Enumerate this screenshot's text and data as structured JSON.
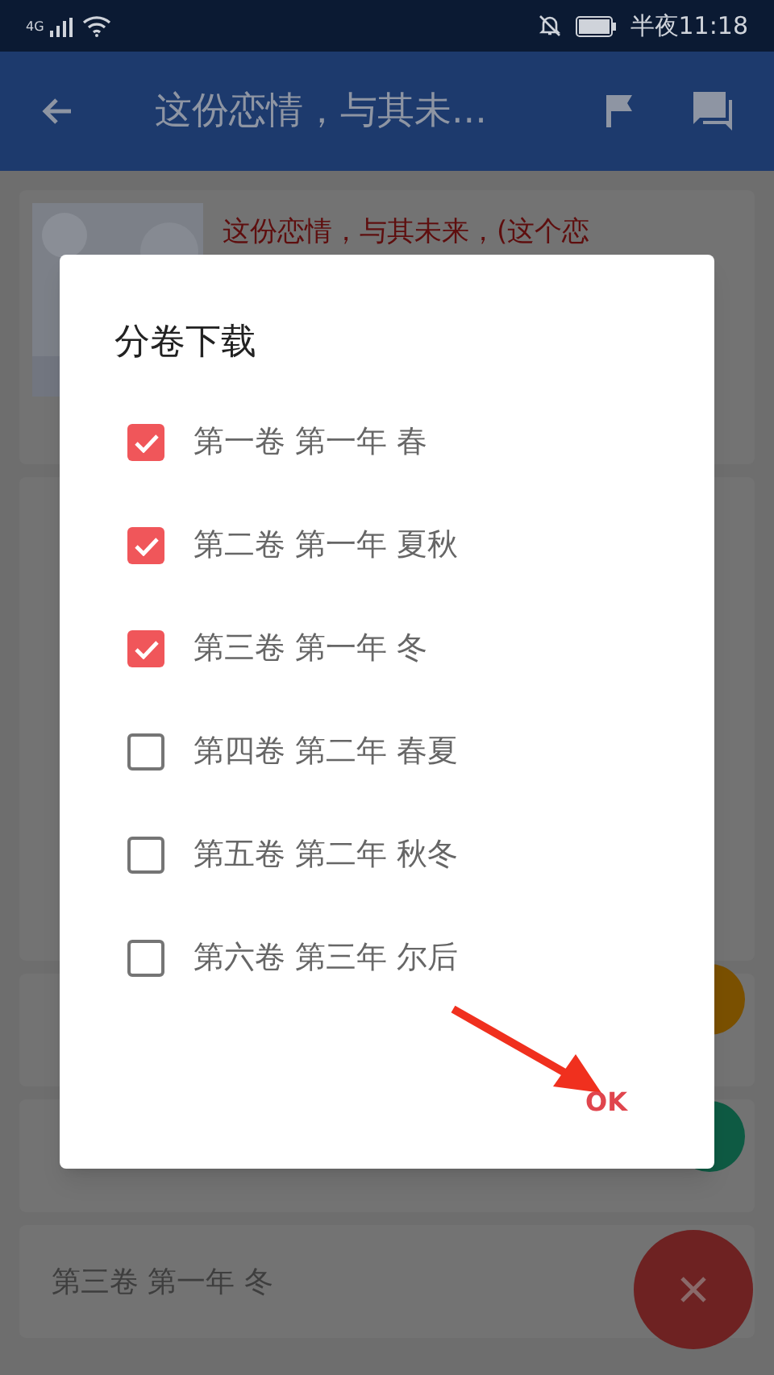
{
  "status_bar": {
    "network": "4G",
    "time": "半夜11:18"
  },
  "app_bar": {
    "title": "这份恋情，与其未..."
  },
  "book": {
    "title": "这份恋情，与其未来，(这个恋"
  },
  "chapter_items": [
    "第三卷 第一年 冬"
  ],
  "dialog": {
    "title": "分卷下载",
    "volumes": [
      {
        "label": "第一卷 第一年 春",
        "checked": true
      },
      {
        "label": "第二卷 第一年 夏秋",
        "checked": true
      },
      {
        "label": "第三卷 第一年 冬",
        "checked": true
      },
      {
        "label": "第四卷 第二年 春夏",
        "checked": false
      },
      {
        "label": "第五卷 第二年 秋冬",
        "checked": false
      },
      {
        "label": "第六卷 第三年 尔后",
        "checked": false
      }
    ],
    "ok_button": "OK"
  }
}
